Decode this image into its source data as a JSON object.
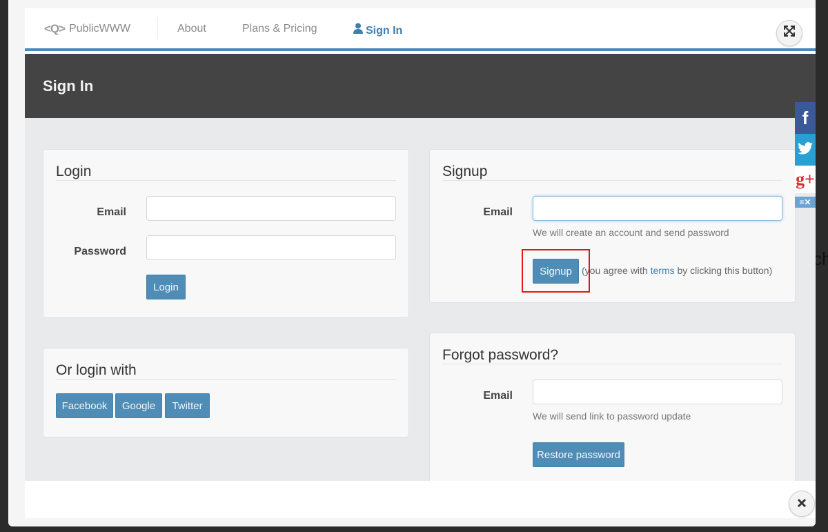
{
  "nav": {
    "logo_glyphs": "<Q>",
    "logo_text": "PublicWWW",
    "links": [
      {
        "label": "About"
      },
      {
        "label": "Plans & Pricing"
      },
      {
        "label": "Sign In",
        "active": true
      }
    ]
  },
  "header": {
    "title": "Sign In"
  },
  "login": {
    "title": "Login",
    "email_label": "Email",
    "email_value": "",
    "password_label": "Password",
    "password_value": "",
    "button": "Login"
  },
  "signup": {
    "title": "Signup",
    "email_label": "Email",
    "email_value": "",
    "help": "We will create an account and send password",
    "button": "Signup",
    "terms_prefix": "(you agree with ",
    "terms_link": "terms",
    "terms_suffix": " by clicking this button)"
  },
  "social_login": {
    "title": "Or login with",
    "buttons": [
      "Facebook",
      "Google",
      "Twitter"
    ]
  },
  "forgot": {
    "title": "Forgot password?",
    "email_label": "Email",
    "email_value": "",
    "help": "We will send link to password update",
    "button": "Restore password"
  },
  "share_bar": {
    "facebook": "f",
    "google_plus": "g+",
    "more": "≡✕"
  },
  "background_text": "ch",
  "colors": {
    "accent": "#4f8db7",
    "header_bg": "#444444",
    "highlight": "#e01818"
  }
}
